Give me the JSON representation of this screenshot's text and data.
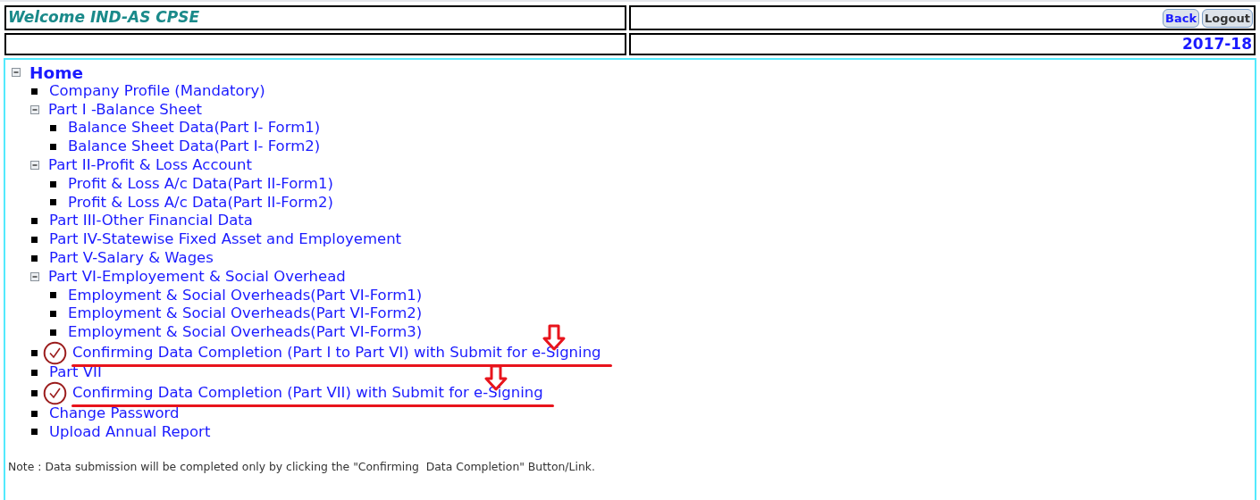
{
  "header": {
    "title": "Welcome IND-AS CPSE",
    "buttons": [
      {
        "label": "Back",
        "kind": "back"
      },
      {
        "label": "Logout",
        "kind": "logout"
      }
    ],
    "year": "2017-18"
  },
  "tree": {
    "label": "Home",
    "kind": "node",
    "expanded": true,
    "children": [
      {
        "label": "Company Profile (Mandatory)",
        "kind": "link",
        "annotated": false
      },
      {
        "label": "Part I -Balance Sheet",
        "kind": "node",
        "expanded": true,
        "children": [
          {
            "label": "Balance Sheet Data(Part I- Form1)",
            "kind": "link",
            "annotated": false
          },
          {
            "label": "Balance Sheet Data(Part I- Form2)",
            "kind": "link",
            "annotated": false
          }
        ]
      },
      {
        "label": "Part II-Profit & Loss Account",
        "kind": "node",
        "expanded": true,
        "children": [
          {
            "label": "Profit & Loss A/c Data(Part II-Form1)",
            "kind": "link",
            "annotated": false
          },
          {
            "label": "Profit & Loss A/c Data(Part II-Form2)",
            "kind": "link",
            "annotated": false
          }
        ]
      },
      {
        "label": "Part III-Other Financial Data",
        "kind": "link",
        "annotated": false
      },
      {
        "label": "Part IV-Statewise Fixed Asset and Employement",
        "kind": "link",
        "annotated": false
      },
      {
        "label": "Part V-Salary & Wages",
        "kind": "link",
        "annotated": false
      },
      {
        "label": "Part VI-Employement & Social Overhead",
        "kind": "node",
        "expanded": true,
        "children": [
          {
            "label": "Employment & Social Overheads(Part VI-Form1)",
            "kind": "link",
            "annotated": false
          },
          {
            "label": "Employment & Social Overheads(Part VI-Form2)",
            "kind": "link",
            "annotated": false
          },
          {
            "label": "Employment & Social Overheads(Part VI-Form3)",
            "kind": "link",
            "annotated": false
          }
        ]
      },
      {
        "label": "Confirming Data Completion (Part I to Part VI) with Submit for e-Signing",
        "kind": "link",
        "annotated": true
      },
      {
        "label": "Part VII",
        "kind": "link",
        "annotated": false
      },
      {
        "label": "Confirming Data Completion (Part VII) with Submit for e-Signing",
        "kind": "link",
        "annotated": true
      },
      {
        "label": "Change Password",
        "kind": "link",
        "annotated": false
      },
      {
        "label": "Upload Annual Report",
        "kind": "link",
        "annotated": false
      }
    ]
  },
  "note": "Note : Data submission will be completed only by clicking the \"Confirming  Data Completion\" Button/Link."
}
